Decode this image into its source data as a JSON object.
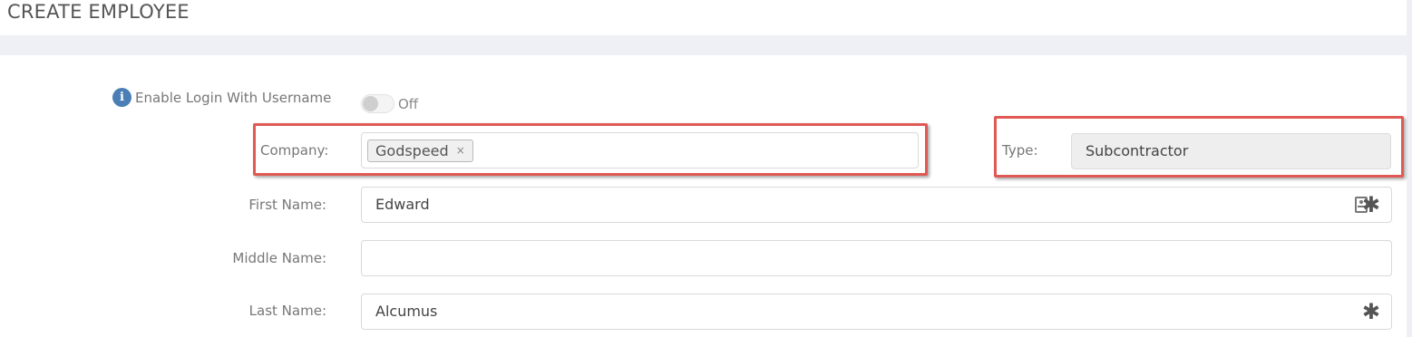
{
  "page": {
    "title": "CREATE EMPLOYEE"
  },
  "login": {
    "label": "Enable Login With Username",
    "toggle_state": "Off",
    "info_icon": "info-icon"
  },
  "company": {
    "label": "Company:",
    "tag": "Godspeed",
    "remove_glyph": "×"
  },
  "type": {
    "label": "Type:",
    "value": "Subcontractor"
  },
  "first_name": {
    "label": "First Name:",
    "value": "Edward",
    "required_mark": "✱"
  },
  "middle_name": {
    "label": "Middle Name:",
    "value": ""
  },
  "last_name": {
    "label": "Last Name:",
    "value": "Alcumus",
    "required_mark": "✱"
  },
  "colors": {
    "highlight": "#e05a55",
    "info_icon": "#4a7fb5",
    "background_gap": "#eef0f6"
  }
}
